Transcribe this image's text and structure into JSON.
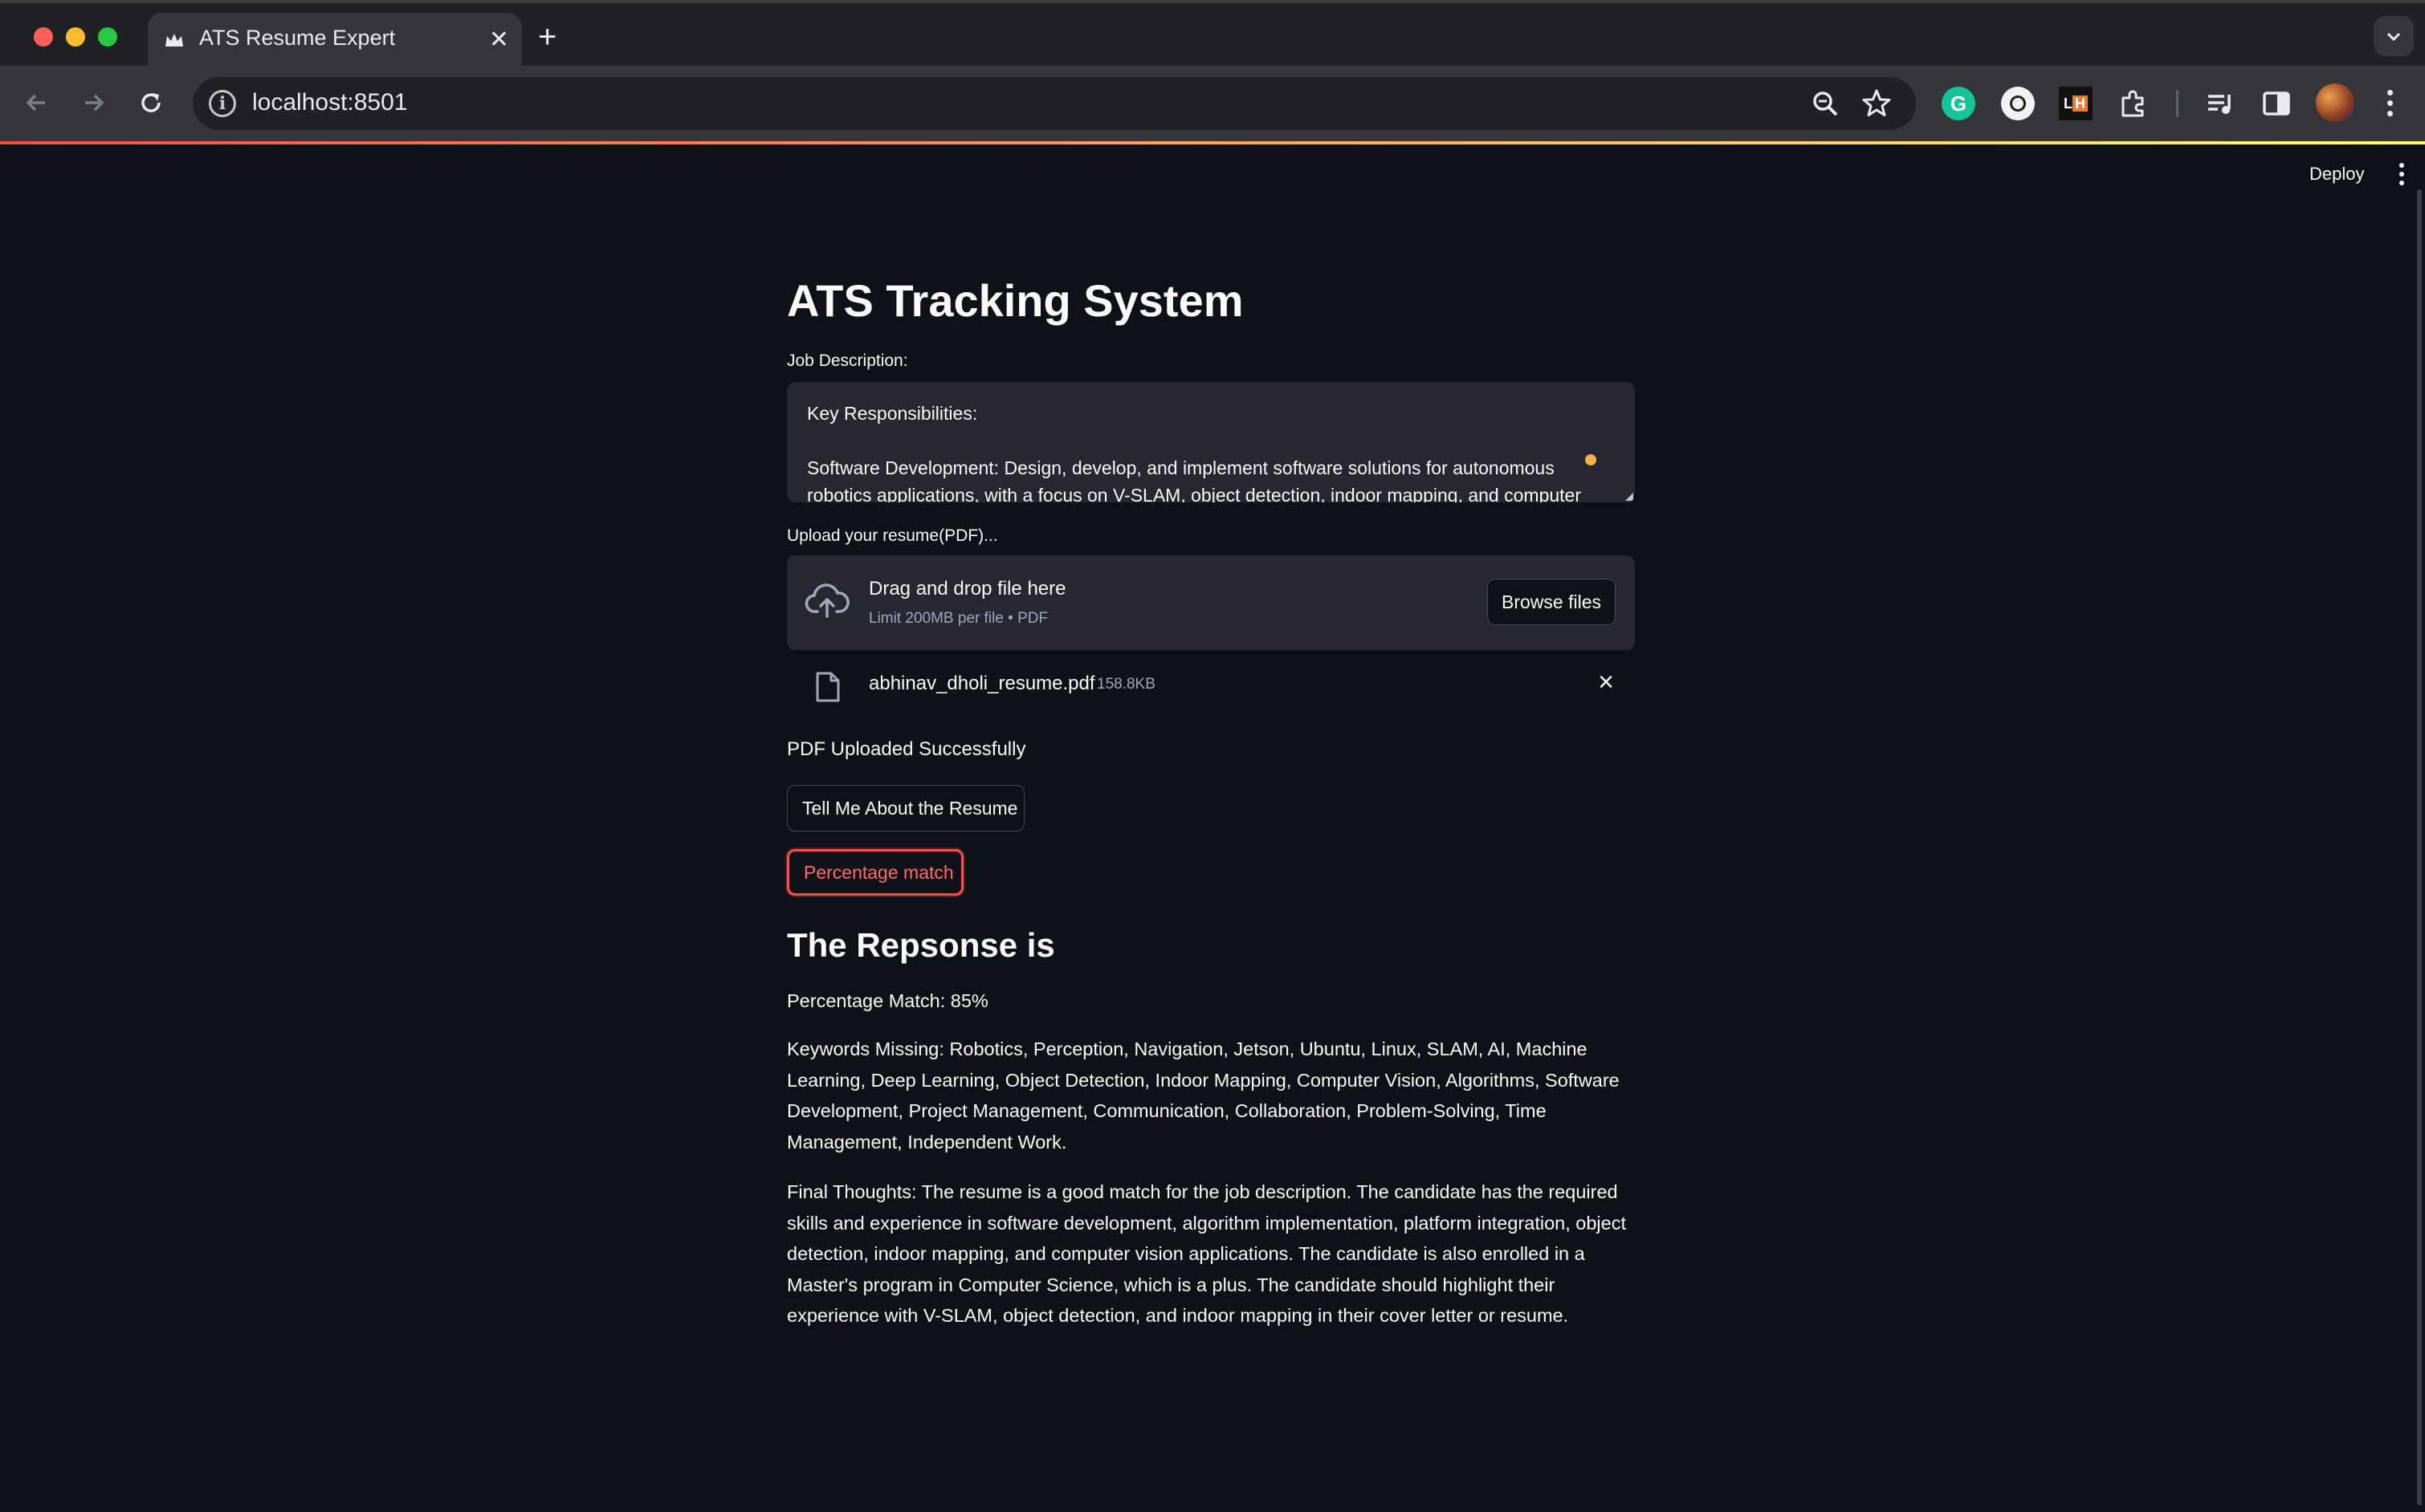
{
  "browser": {
    "tab_title": "ATS Resume Expert",
    "url": "localhost:8501"
  },
  "app": {
    "deploy_label": "Deploy",
    "title": "ATS Tracking System",
    "job_description": {
      "label": "Job Description:",
      "lines": [
        "Key Responsibilities:",
        "Software Development: Design, develop, and implement software solutions for autonomous",
        "robotics applications, with a focus on V-SLAM, object detection, indoor mapping, and computer"
      ]
    },
    "uploader": {
      "label": "Upload your resume(PDF)...",
      "dropzone_title": "Drag and drop file here",
      "dropzone_sub": "Limit 200MB per file • PDF",
      "browse_label": "Browse files",
      "file_name": "abhinav_dholi_resume.pdf",
      "file_size": "158.8KB"
    },
    "status_text": "PDF Uploaded Successfully",
    "buttons": {
      "tell_me": "Tell Me About the Resume",
      "percentage": "Percentage match"
    },
    "response": {
      "title": "The Repsonse is",
      "match": "Percentage Match: 85%",
      "missing": "Keywords Missing: Robotics, Perception, Navigation, Jetson, Ubuntu, Linux, SLAM, AI, Machine Learning, Deep Learning, Object Detection, Indoor Mapping, Computer Vision, Algorithms, Software Development, Project Management, Communication, Collaboration, Problem-Solving, Time Management, Independent Work.",
      "final": "Final Thoughts: The resume is a good match for the job description. The candidate has the required skills and experience in software development, algorithm implementation, platform integration, object detection, indoor mapping, and computer vision applications. The candidate is also enrolled in a Master's program in Computer Science, which is a plus. The candidate should highlight their experience with V-SLAM, object detection, and indoor mapping in their cover letter or resume."
    }
  },
  "colors": {
    "background": "#0e1117",
    "input_bg": "#262730",
    "accent": "#ff4b4b"
  }
}
